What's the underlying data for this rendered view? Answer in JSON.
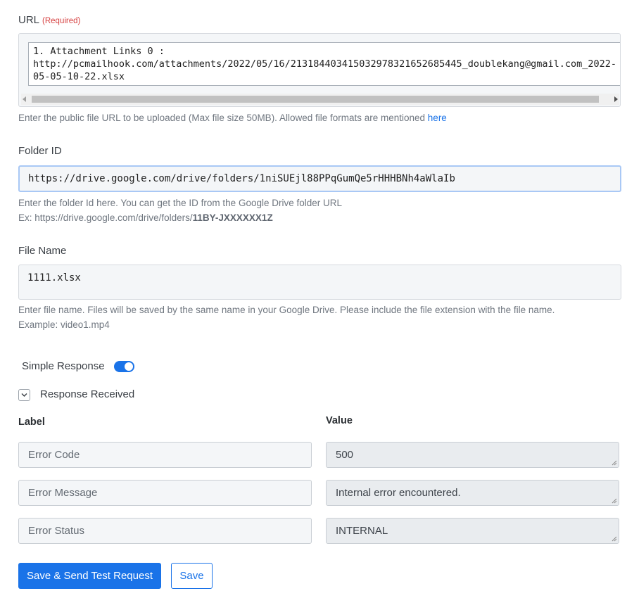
{
  "url": {
    "label": "URL",
    "required": "(Required)",
    "value": "1. Attachment Links 0 :\nhttp://pcmailhook.com/attachments/2022/05/16/213184403415032978321652685445_doublekang@gmail.com_2022-\n05-05-10-22.xlsx",
    "help": "Enter the public file URL to be uploaded (Max file size 50MB). Allowed file formats are mentioned ",
    "help_link": "here"
  },
  "folder": {
    "label": "Folder ID",
    "value": "https://drive.google.com/drive/folders/1niSUEjl88PPqGumQe5rHHHBNh4aWlaIb",
    "help_line1": "Enter the folder Id here. You can get the ID from the Google Drive folder URL",
    "help_line2_prefix": "Ex: https://drive.google.com/drive/folders/",
    "help_line2_bold": "11BY-JXXXXXX1Z"
  },
  "file_name": {
    "label": "File Name",
    "value": "1111.xlsx",
    "help_line1": "Enter file name. Files will be saved by the same name in your Google Drive. Please include the file extension with the file name.",
    "help_line2": "Example: video1.mp4"
  },
  "simple_response": {
    "label": "Simple Response",
    "enabled": true
  },
  "response_received": {
    "label": "Response Received"
  },
  "table": {
    "label_header": "Label",
    "value_header": "Value",
    "rows": [
      {
        "label": "Error Code",
        "value": "500"
      },
      {
        "label": "Error Message",
        "value": "Internal error encountered."
      },
      {
        "label": "Error Status",
        "value": "INTERNAL"
      }
    ]
  },
  "buttons": {
    "test": "Save & Send Test Request",
    "save": "Save"
  },
  "colors": {
    "accent": "#1a73e8",
    "required": "#d64040"
  }
}
